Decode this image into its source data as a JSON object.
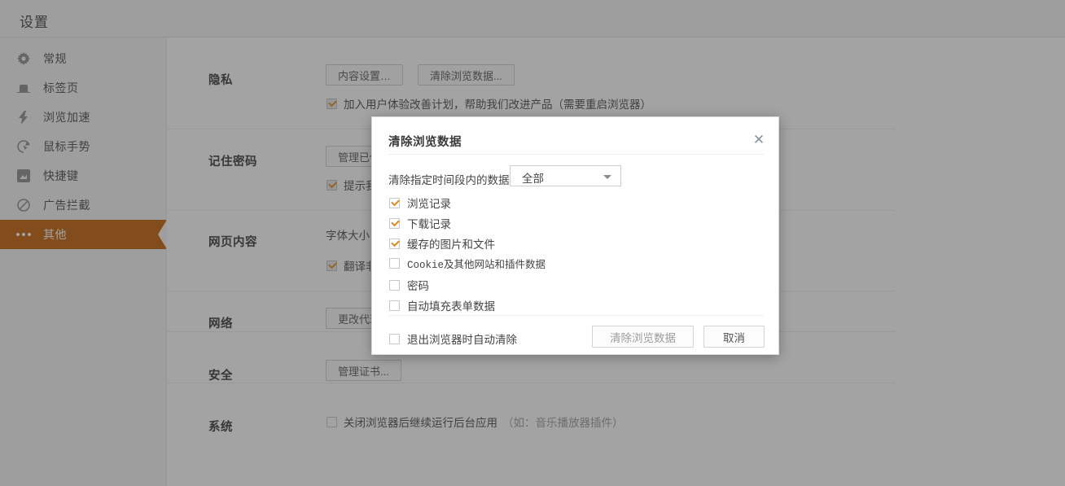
{
  "window": {
    "title": "设置"
  },
  "sidebar": {
    "items": [
      {
        "label": "常规",
        "icon": "gear-icon",
        "active": false
      },
      {
        "label": "标签页",
        "icon": "tab-icon",
        "active": false
      },
      {
        "label": "浏览加速",
        "icon": "lightning-icon",
        "active": false
      },
      {
        "label": "鼠标手势",
        "icon": "cursor-gesture-icon",
        "active": false
      },
      {
        "label": "快捷键",
        "icon": "keyboard-shortcut-icon",
        "active": false
      },
      {
        "label": "广告拦截",
        "icon": "block-icon",
        "active": false
      },
      {
        "label": "其他",
        "icon": "ellipsis-icon",
        "active": true
      }
    ]
  },
  "settings": {
    "sections": [
      {
        "name": "隐私",
        "buttons": [
          "内容设置…",
          "清除浏览数据..."
        ],
        "checkbox": {
          "label": "加入用户体验改善计划，帮助我们改进产品（需要重启浏览器）",
          "checked": true
        }
      },
      {
        "name": "记住密码",
        "buttons": [
          "管理已保存的密码..."
        ],
        "checkbox": {
          "label": "提示我保存密码",
          "checked": true
        }
      },
      {
        "name": "网页内容",
        "inline_label": "字体大小：",
        "checkbox": {
          "label": "翻译非中文网页",
          "checked": true
        }
      },
      {
        "name": "网络",
        "buttons": [
          "更改代理服务器设置..."
        ]
      },
      {
        "name": "安全",
        "buttons": [
          "管理证书..."
        ]
      },
      {
        "name": "系统",
        "checkbox": {
          "label": "关闭浏览器后继续运行后台应用",
          "hint": "（如：音乐播放器插件）",
          "checked": false
        }
      }
    ]
  },
  "dialog": {
    "title": "清除浏览数据",
    "close_icon": "close-icon",
    "period_label": "清除指定时间段内的数据：",
    "period_value": "全部",
    "options": [
      {
        "label": "浏览记录",
        "checked": true,
        "mono": false
      },
      {
        "label": "下载记录",
        "checked": true,
        "mono": false
      },
      {
        "label": "缓存的图片和文件",
        "checked": true,
        "mono": false
      },
      {
        "label": "Cookie及其他网站和插件数据",
        "checked": false,
        "mono": true
      },
      {
        "label": "密码",
        "checked": false,
        "mono": false
      },
      {
        "label": "自动填充表单数据",
        "checked": false,
        "mono": false
      }
    ],
    "auto_clear": {
      "label": "退出浏览器时自动清除",
      "checked": false
    },
    "confirm_label": "清除浏览数据",
    "cancel_label": "取消"
  },
  "colors": {
    "accent": "#c05c00",
    "check": "#e08a1e",
    "scrim": "rgba(60,60,60,0.47)"
  }
}
